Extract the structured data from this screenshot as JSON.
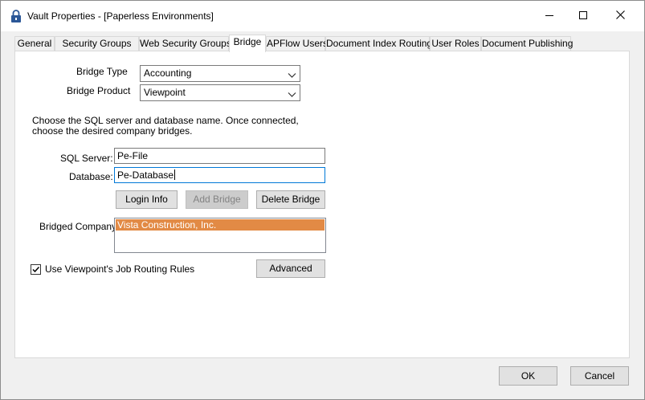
{
  "window": {
    "title": "Vault Properties - [Paperless Environments]",
    "icon": "lock-icon",
    "controls": {
      "minimize": "minimize-icon",
      "maximize": "maximize-icon",
      "close": "close-icon"
    }
  },
  "tabs": [
    {
      "label": "General",
      "active": false
    },
    {
      "label": "Security Groups",
      "active": false
    },
    {
      "label": "Web Security Groups",
      "active": false
    },
    {
      "label": "Bridge",
      "active": true
    },
    {
      "label": "APFlow Users",
      "active": false
    },
    {
      "label": "Document Index Routing",
      "active": false
    },
    {
      "label": "User Roles",
      "active": false
    },
    {
      "label": "Document Publishing",
      "active": false
    }
  ],
  "bridge": {
    "bridge_type_label": "Bridge Type",
    "bridge_type_value": "Accounting",
    "bridge_product_label": "Bridge Product",
    "bridge_product_value": "Viewpoint",
    "instructions": "Choose the SQL server and database name.  Once connected, choose the desired company bridges.",
    "sql_server_label": "SQL Server:",
    "sql_server_value": "Pe-File",
    "database_label": "Database:",
    "database_value": "Pe-Database",
    "login_info_button": "Login Info",
    "add_bridge_button": "Add Bridge",
    "delete_bridge_button": "Delete Bridge",
    "bridged_company_label": "Bridged Company:",
    "bridged_companies": [
      "Vista Construction, Inc."
    ],
    "job_routing_checkbox_label": "Use Viewpoint's Job Routing Rules",
    "job_routing_checked": true,
    "advanced_button": "Advanced"
  },
  "footer": {
    "ok_button": "OK",
    "cancel_button": "Cancel"
  },
  "colors": {
    "selection": "#e28a45",
    "focus_border": "#0078d7"
  }
}
